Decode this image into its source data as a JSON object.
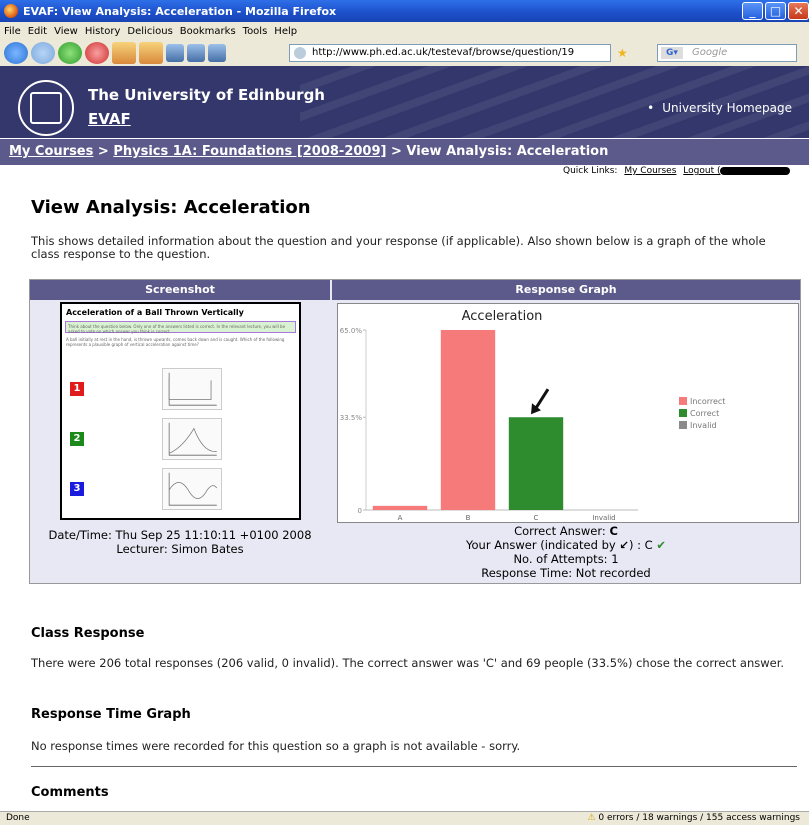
{
  "window": {
    "title": "EVAF: View Analysis: Acceleration - Mozilla Firefox"
  },
  "menu": [
    "File",
    "Edit",
    "View",
    "History",
    "Delicious",
    "Bookmarks",
    "Tools",
    "Help"
  ],
  "url": "http://www.ph.ed.ac.uk/testevaf/browse/question/19",
  "search_placeholder": "Google",
  "header": {
    "university": "The University of Edinburgh",
    "app": "EVAF",
    "home_link": "University Homepage"
  },
  "breadcrumb": {
    "my_courses": "My Courses",
    "sep": ">",
    "course": "Physics 1A: Foundations [2008-2009]",
    "current": "View Analysis: Acceleration"
  },
  "quick_links": {
    "label": "Quick Links:",
    "my_courses": "My Courses",
    "logout": "Logout ("
  },
  "page": {
    "title": "View Analysis: Acceleration",
    "intro": "This shows detailed information about the question and your response (if applicable). Also shown below is a graph of the whole class response to the question."
  },
  "table": {
    "col_screenshot": "Screenshot",
    "col_graph": "Response Graph",
    "screenshot": {
      "title": "Acceleration of a Ball Thrown Vertically",
      "note": "Think about the question below. Only one of the answers listed is correct. In the relevant lecture, you will be asked to vote on which answer you think is correct.",
      "question": "A ball initially at rest in the hand, is thrown upwards, comes back down and is caught. Which of the following represents a plausible graph of vertical acceleration against time?",
      "options": [
        "1",
        "2",
        "3"
      ],
      "option_colors": [
        "#e01b1b",
        "#1b8a1b",
        "#1b1be0"
      ]
    },
    "datetime": "Date/Time: Thu Sep 25 11:10:11 +0100 2008",
    "lecturer": "Lecturer: Simon Bates",
    "correct_answer_label": "Correct Answer:",
    "correct_answer": "C",
    "your_answer_label": "Your Answer (indicated by",
    "your_answer_value": ") : C",
    "attempts": "No. of Attempts: 1",
    "response_time": "Response Time: Not recorded"
  },
  "chart_data": {
    "type": "bar",
    "title": "Acceleration",
    "categories": [
      "A",
      "B",
      "C",
      "Invalid"
    ],
    "values": [
      1.5,
      65.0,
      33.5,
      0
    ],
    "bar_status": [
      "Incorrect",
      "Incorrect",
      "Correct",
      "Invalid"
    ],
    "colors": {
      "Incorrect": "#f77a7a",
      "Correct": "#2e8b2e",
      "Invalid": "#8a8a8a"
    },
    "y_ticks": [
      "0",
      "33.5%",
      "65.0%"
    ],
    "ylim": [
      0,
      65
    ],
    "legend": [
      "Incorrect",
      "Correct",
      "Invalid"
    ],
    "legend_position": "right",
    "marker_category": "C"
  },
  "sections": {
    "class_response_title": "Class Response",
    "class_response_text": "There were 206 total responses (206 valid, 0 invalid). The correct answer was 'C' and 69 people (33.5%) chose the correct answer.",
    "response_time_title": "Response Time Graph",
    "response_time_text": "No response times were recorded for this question so a graph is not available - sorry.",
    "comments_title": "Comments"
  },
  "status": {
    "left": "Done",
    "right": "0 errors / 18 warnings / 155 access warnings"
  }
}
